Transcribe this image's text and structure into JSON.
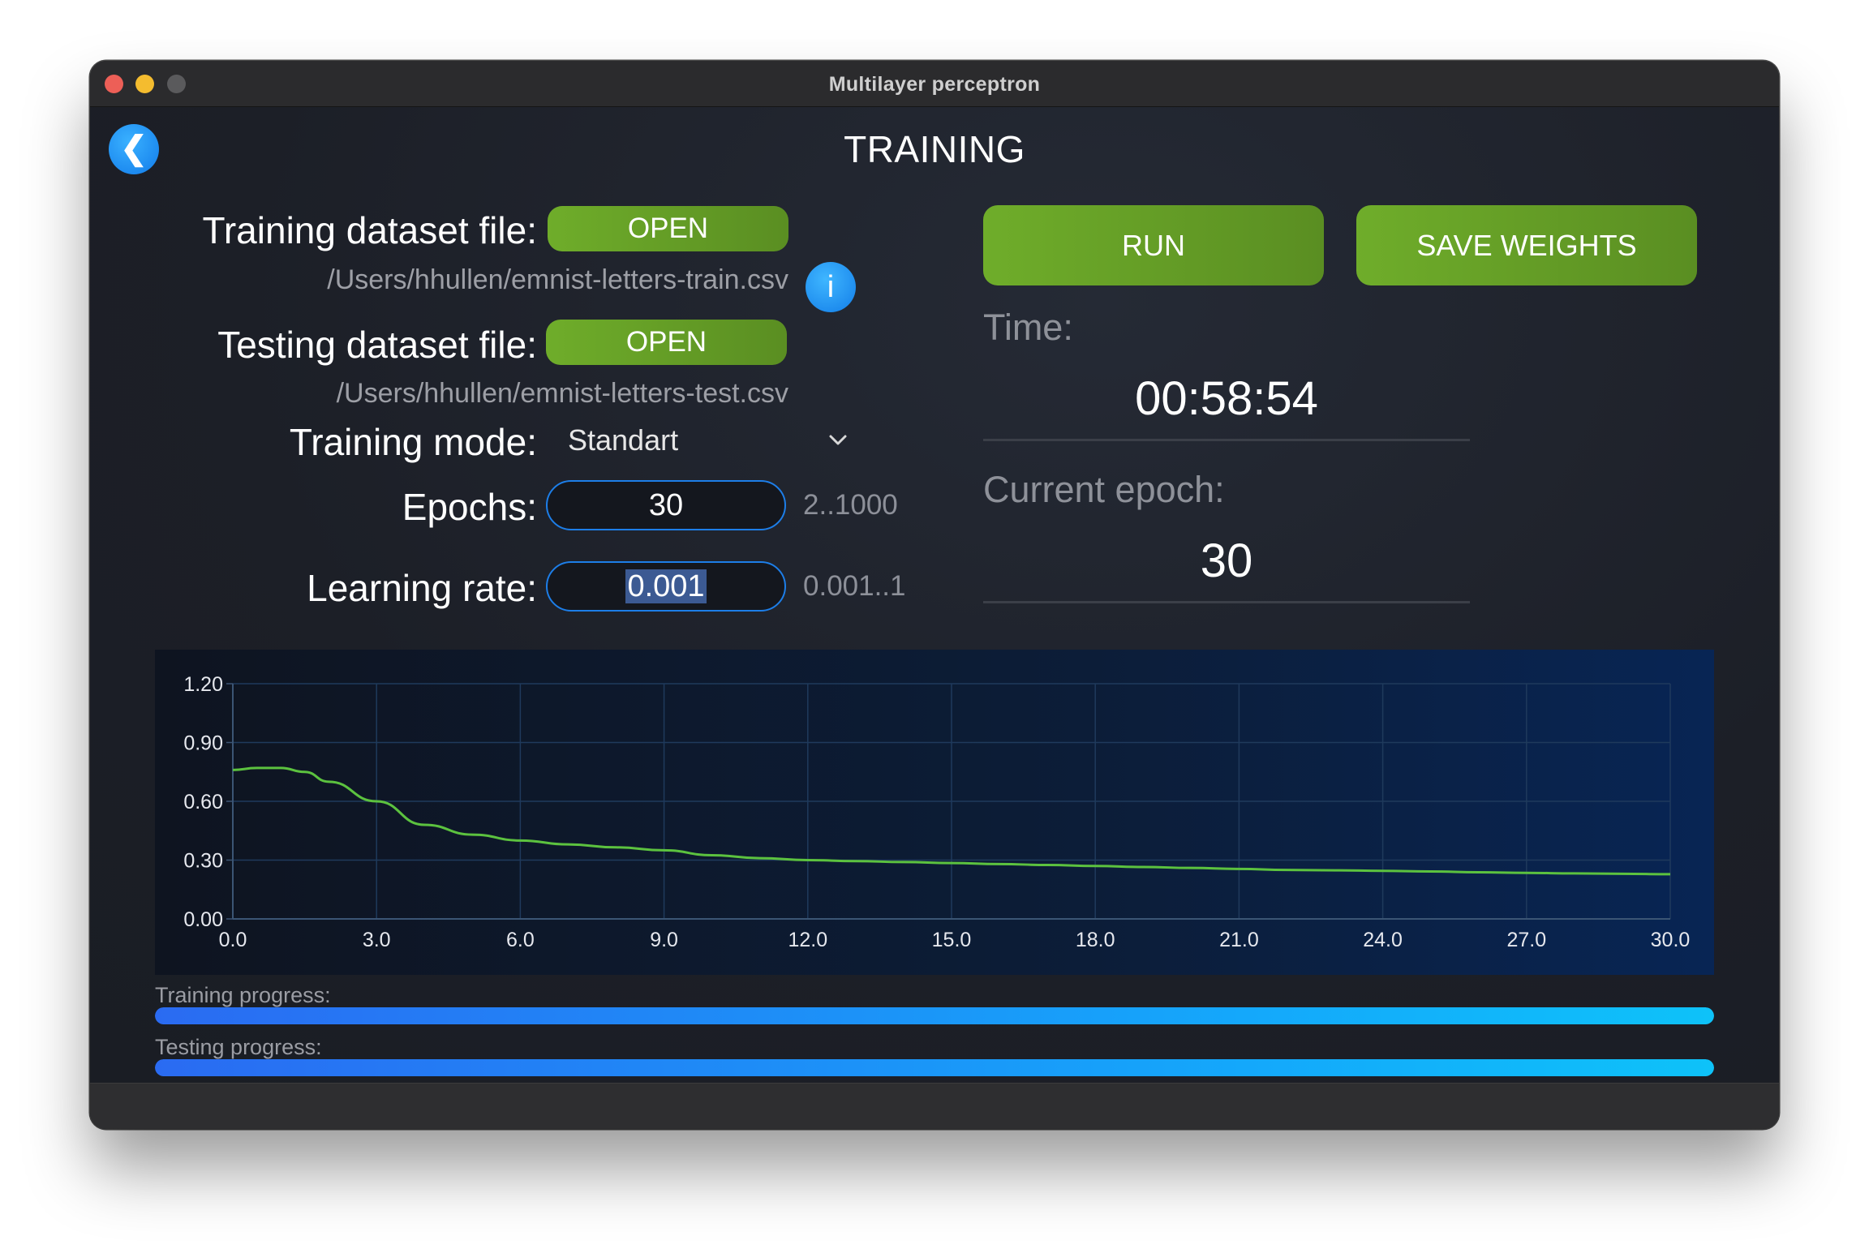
{
  "window": {
    "title": "Multilayer perceptron"
  },
  "page": {
    "title": "TRAINING"
  },
  "training_file": {
    "label": "Training dataset file:",
    "button": "OPEN",
    "path": "/Users/hhullen/emnist-letters-train.csv"
  },
  "info_button": {
    "glyph": "i"
  },
  "testing_file": {
    "label": "Testing dataset file:",
    "button": "OPEN",
    "path": "/Users/hhullen/emnist-letters-test.csv"
  },
  "training_mode": {
    "label": "Training mode:",
    "value": "Standart"
  },
  "epochs": {
    "label": "Epochs:",
    "value": "30",
    "range": "2..1000"
  },
  "learning_rate": {
    "label": "Learning rate:",
    "value": "0.001",
    "range": "0.001..1"
  },
  "actions": {
    "run": "RUN",
    "save_weights": "SAVE WEIGHTS"
  },
  "time": {
    "label": "Time:",
    "value": "00:58:54"
  },
  "current_epoch": {
    "label": "Current epoch:",
    "value": "30"
  },
  "progress": {
    "training_label": "Training progress:",
    "training_value": 1.0,
    "testing_label": "Testing progress:",
    "testing_value": 1.0
  },
  "colors": {
    "accent_green": "#6fad2a",
    "accent_blue": "#1d7ee8",
    "line_green": "#5cc23f",
    "background": "#1d2028"
  },
  "icons": {
    "back": "chevron-left-icon",
    "info": "info-icon",
    "dropdown": "chevron-down-icon"
  },
  "chart_data": {
    "type": "line",
    "title": "",
    "xlabel": "",
    "ylabel": "",
    "xlim": [
      0,
      30
    ],
    "ylim": [
      0,
      1.2
    ],
    "x_ticks": [
      "0.0",
      "3.0",
      "6.0",
      "9.0",
      "12.0",
      "15.0",
      "18.0",
      "21.0",
      "24.0",
      "27.0",
      "30.0"
    ],
    "y_ticks": [
      "0.00",
      "0.30",
      "0.60",
      "0.90",
      "1.20"
    ],
    "grid": true,
    "series": [
      {
        "x": [
          0,
          0.5,
          1,
          1.5,
          2,
          3,
          4,
          5,
          6,
          7,
          8,
          9,
          10,
          11,
          12,
          13,
          14,
          15,
          16,
          17,
          18,
          19,
          20,
          21,
          22,
          23,
          24,
          25,
          26,
          27,
          28,
          29,
          30
        ],
        "y": [
          0.76,
          0.77,
          0.77,
          0.75,
          0.7,
          0.6,
          0.48,
          0.43,
          0.4,
          0.38,
          0.365,
          0.35,
          0.325,
          0.31,
          0.3,
          0.295,
          0.29,
          0.285,
          0.28,
          0.275,
          0.27,
          0.265,
          0.26,
          0.255,
          0.25,
          0.248,
          0.245,
          0.242,
          0.238,
          0.235,
          0.232,
          0.23,
          0.228
        ]
      }
    ]
  }
}
